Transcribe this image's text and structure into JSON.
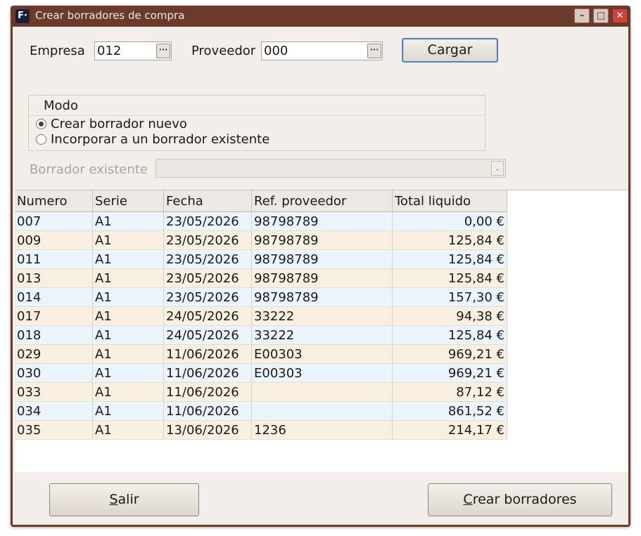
{
  "window": {
    "title": "Crear borradores de compra",
    "icon_text": "F·"
  },
  "form": {
    "empresa_label": "Empresa",
    "empresa_value": "012",
    "proveedor_label": "Proveedor",
    "proveedor_value": "000",
    "lookup_glyph": "···",
    "cargar_label": "Cargar"
  },
  "modo": {
    "title": "Modo",
    "options": [
      {
        "label": "Crear borrador nuevo",
        "selected": true
      },
      {
        "label": "Incorporar a un borrador existente",
        "selected": false
      }
    ]
  },
  "borrador": {
    "label": "Borrador existente",
    "value": ""
  },
  "table": {
    "columns": [
      "Numero",
      "Serie",
      "Fecha",
      "Ref. proveedor",
      "Total liquido"
    ],
    "rows": [
      [
        "007",
        "A1",
        "23/05/2026",
        "98798789",
        "0,00 €"
      ],
      [
        "009",
        "A1",
        "23/05/2026",
        "98798789",
        "125,84 €"
      ],
      [
        "011",
        "A1",
        "23/05/2026",
        "98798789",
        "125,84 €"
      ],
      [
        "013",
        "A1",
        "23/05/2026",
        "98798789",
        "125,84 €"
      ],
      [
        "014",
        "A1",
        "23/05/2026",
        "98798789",
        "157,30 €"
      ],
      [
        "017",
        "A1",
        "24/05/2026",
        "33222",
        "94,38 €"
      ],
      [
        "018",
        "A1",
        "24/05/2026",
        "33222",
        "125,84 €"
      ],
      [
        "029",
        "A1",
        "11/06/2026",
        "E00303",
        "969,21 €"
      ],
      [
        "030",
        "A1",
        "11/06/2026",
        "E00303",
        "969,21 €"
      ],
      [
        "033",
        "A1",
        "11/06/2026",
        "",
        "87,12 €"
      ],
      [
        "034",
        "A1",
        "11/06/2026",
        "",
        "861,52 €"
      ],
      [
        "035",
        "A1",
        "13/06/2026",
        "1236",
        "214,17 €"
      ]
    ]
  },
  "buttons": {
    "salir_first": "S",
    "salir_rest": "alir",
    "crear_first": "C",
    "crear_rest": "rear borradores"
  },
  "colors": {
    "row_blue": "#ecf4fb",
    "row_beige": "#f8efe1",
    "titlebar": "#6b3a2a"
  }
}
